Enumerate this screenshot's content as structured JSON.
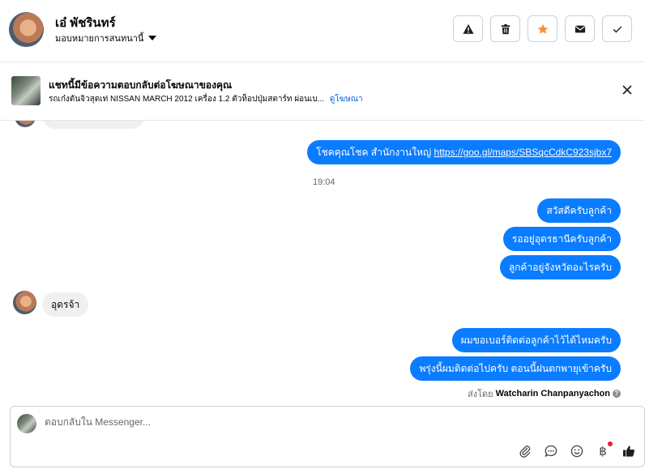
{
  "header": {
    "name": "เอ๋ พัชรินทร์",
    "assign_label": "มอบหมายการสนทนานี้",
    "actions": [
      {
        "icon": "warning-icon",
        "label": "Spam"
      },
      {
        "icon": "trash-icon",
        "label": "Delete"
      },
      {
        "icon": "star-icon",
        "label": "Star"
      },
      {
        "icon": "envelope-icon",
        "label": "Mark unread"
      },
      {
        "icon": "check-icon",
        "label": "Done"
      }
    ],
    "star_color": "#f7923b"
  },
  "ad": {
    "title": "แชทนี้มีข้อความตอบกลับต่อโฆษณาของคุณ",
    "subtitle": "รถเก๋งตันจิวสุดเท่ NISSAN MARCH 2012 เครื่อง 1.2 ตัวท็อปปุ่มสตาร์ท ผ่อนเบ...",
    "link": "ดูโฆษณา"
  },
  "messages": {
    "m1_text": "โชคคุณโชค สำนักงานใหญ่ ",
    "m1_link": "https://goo.gl/maps/SBSqcCdkC923sjbx7",
    "time": "19:04",
    "m2": "สวัสดีครับลูกค้า",
    "m3": "รออยู่อุดรธานีครับลูกค้า",
    "m4": "ลูกค้าอยู่จังหวัดอะไรครับ",
    "m5": "อุดรจ้า",
    "m6": "ผมขอเบอร์ติดต่อลูกค้าไว้ได้ไหมครับ",
    "m7": "พรุ่งนี้ผมติดต่อไปครับ ตอนนี้ฝนตกพายุเข้าครับ",
    "sent_by_label": "ส่งโดย",
    "sent_by_name": "Watcharin Chanpanyachon",
    "outgoing_color": "#0a7cff"
  },
  "composer": {
    "placeholder": "ตอบกลับใน Messenger...",
    "tools": [
      "paperclip-icon",
      "chat-bubble-icon",
      "emoji-icon",
      "baht-icon",
      "thumbs-up-icon"
    ],
    "baht_symbol": "฿"
  }
}
